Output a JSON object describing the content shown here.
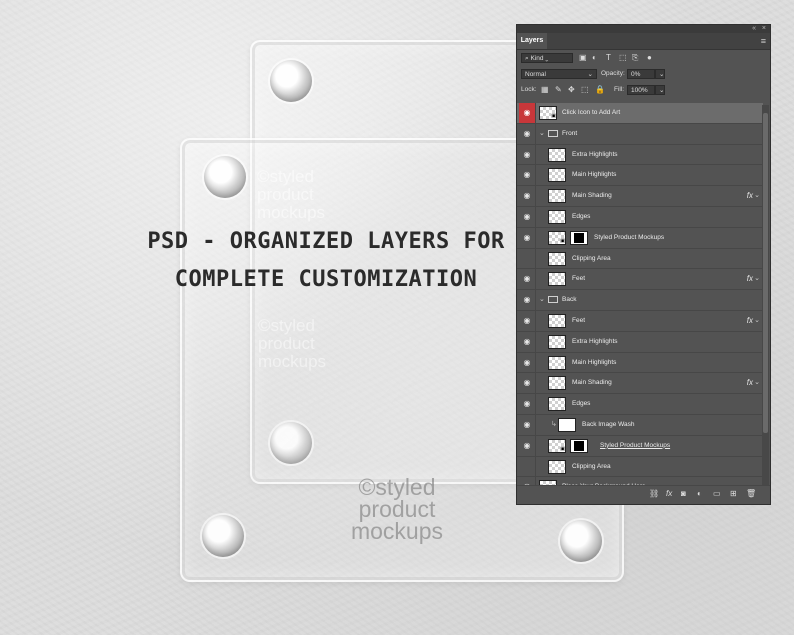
{
  "headline": {
    "line1": "PSD - Organized Layers for",
    "line2": "Complete Customization"
  },
  "watermark": {
    "line1": "©styled",
    "line2": "product",
    "line3": "mockups"
  },
  "panel": {
    "tab_label": "Layers",
    "filter_kind": "Kind",
    "blend_mode": "Normal",
    "opacity_label": "Opacity:",
    "opacity_value": "0%",
    "lock_label": "Lock:",
    "fill_label": "Fill:",
    "fill_value": "100%",
    "layers": [
      "Click Icon to Add Art",
      "Front",
      "Extra Highlights",
      "Main Highlights",
      "Main Shading",
      "Edges",
      "Styled Product Mockups",
      "Clipping Area",
      "Feet",
      "Back",
      "Feet",
      "Extra Highlights",
      "Main Highlights",
      "Main Shading",
      "Edges",
      "Back Image Wash",
      "Styled Product Mockups",
      "Clipping Area",
      "Place Your Background Here"
    ],
    "fx_label": "fx"
  },
  "icons": {
    "eye": "eye-icon",
    "folder": "folder-icon",
    "search": "search-icon",
    "menu": "panel-menu-icon"
  },
  "colors": {
    "panel_bg": "#535353",
    "selected_eye": "#c8373a",
    "headline": "#2b2b2b"
  }
}
